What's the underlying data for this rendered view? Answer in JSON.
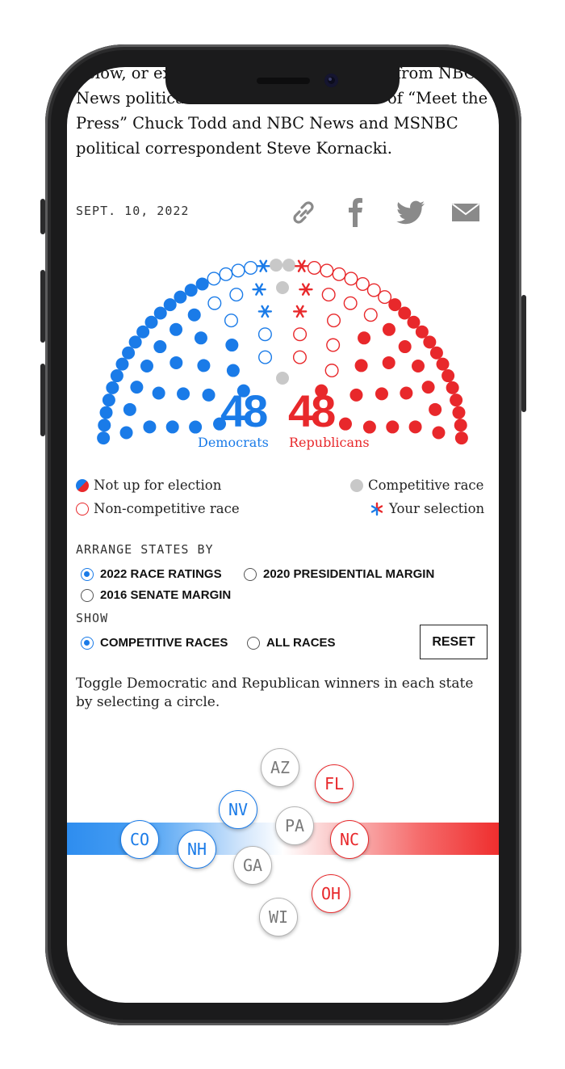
{
  "article": {
    "intro": "below, or explore the competitive races from NBC News political director and moderator of “Meet the Press” Chuck Todd and NBC News and MSNBC political correspondent Steve Kornacki.",
    "date": "SEPT. 10, 2022"
  },
  "share": {
    "icons": [
      "link-icon",
      "facebook-icon",
      "twitter-icon",
      "email-icon"
    ]
  },
  "colors": {
    "democrat": "#1a7be8",
    "republican": "#e8282b",
    "competitive": "#c8c8c8"
  },
  "chamber": {
    "democrats_count": "48",
    "democrats_label": "Democrats",
    "republicans_count": "48",
    "republicans_label": "Republicans",
    "seats": {
      "dem_not_up": 36,
      "dem_noncompetitive": 9,
      "dem_selected": 3,
      "competitive": 4,
      "rep_selected": 3,
      "rep_noncompetitive": 15,
      "rep_not_up": 30
    }
  },
  "legend": {
    "not_up": "Not up for election",
    "competitive": "Competitive race",
    "noncompetitive": "Non-competitive race",
    "selection": "Your selection"
  },
  "controls": {
    "arrange_heading": "ARRANGE STATES BY",
    "arrange_options": [
      "2022 RACE RATINGS",
      "2020 PRESIDENTIAL MARGIN",
      "2016 SENATE MARGIN"
    ],
    "arrange_selected": "2022 RACE RATINGS",
    "show_heading": "SHOW",
    "show_options": [
      "COMPETITIVE RACES",
      "ALL RACES"
    ],
    "show_selected": "COMPETITIVE RACES",
    "reset_label": "RESET"
  },
  "hint": "Toggle Democratic and Republican winners in each state by selecting a circle.",
  "states": [
    {
      "abbr": "AZ",
      "party": "competitive"
    },
    {
      "abbr": "FL",
      "party": "republican"
    },
    {
      "abbr": "NV",
      "party": "democrat"
    },
    {
      "abbr": "PA",
      "party": "competitive"
    },
    {
      "abbr": "CO",
      "party": "democrat"
    },
    {
      "abbr": "NH",
      "party": "democrat"
    },
    {
      "abbr": "NC",
      "party": "republican"
    },
    {
      "abbr": "GA",
      "party": "competitive"
    },
    {
      "abbr": "OH",
      "party": "republican"
    },
    {
      "abbr": "WI",
      "party": "competitive"
    }
  ]
}
